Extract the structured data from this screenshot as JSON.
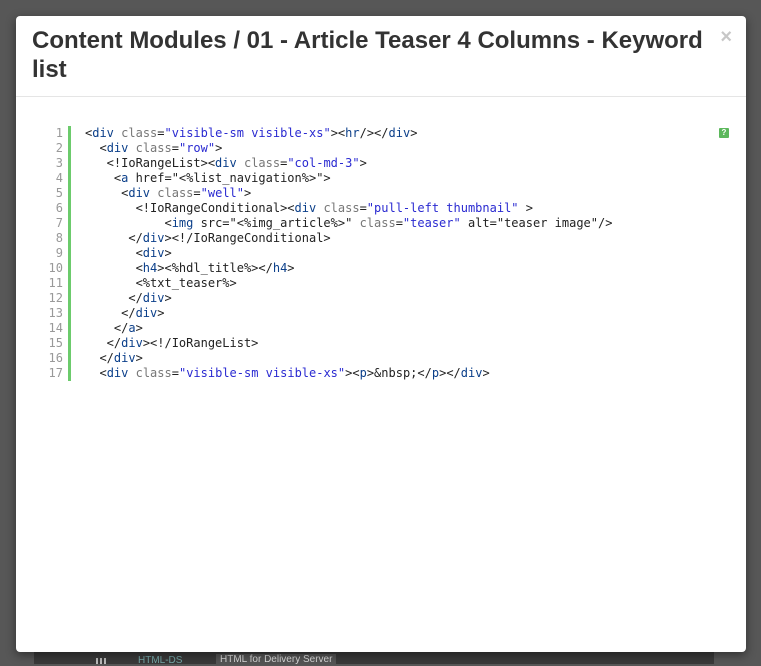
{
  "modal": {
    "title": "Content Modules / 01 - Article Teaser 4 Columns - Keyword list",
    "close_label": "×",
    "help_label": "?"
  },
  "code": {
    "lines": [
      {
        "n": "1",
        "text": "<div class=\"visible-sm visible-xs\"><hr/></div>"
      },
      {
        "n": "2",
        "text": "  <div class=\"row\">"
      },
      {
        "n": "3",
        "text": "   <!IoRangeList><div class=\"col-md-3\">"
      },
      {
        "n": "4",
        "text": "    <a href=\"<%list_navigation%>\">"
      },
      {
        "n": "5",
        "text": "     <div class=\"well\">"
      },
      {
        "n": "6",
        "text": "       <!IoRangeConditional><div class=\"pull-left thumbnail\" >"
      },
      {
        "n": "7",
        "text": "           <img src=\"<%img_article%>\" class=\"teaser\" alt=\"teaser image\"/>"
      },
      {
        "n": "8",
        "text": "      </div><!/IoRangeConditional>"
      },
      {
        "n": "9",
        "text": "       <div>"
      },
      {
        "n": "10",
        "text": "       <h4><%hdl_title%></h4>"
      },
      {
        "n": "11",
        "text": "       <%txt_teaser%>"
      },
      {
        "n": "12",
        "text": "      </div>"
      },
      {
        "n": "13",
        "text": "     </div>"
      },
      {
        "n": "14",
        "text": "    </a>"
      },
      {
        "n": "15",
        "text": "   </div><!/IoRangeList>"
      },
      {
        "n": "16",
        "text": "  </div>"
      },
      {
        "n": "17",
        "text": "  <div class=\"visible-sm visible-xs\"><p>&nbsp;</p></div>"
      }
    ]
  },
  "background": {
    "tab_html": "HTML-DS",
    "tab_delivery": "HTML for Delivery Server"
  },
  "colors": {
    "tag": "#0b3f8a",
    "attr": "#777777",
    "string": "#2a2ad1",
    "gutter_bar": "#6ccb6c"
  }
}
